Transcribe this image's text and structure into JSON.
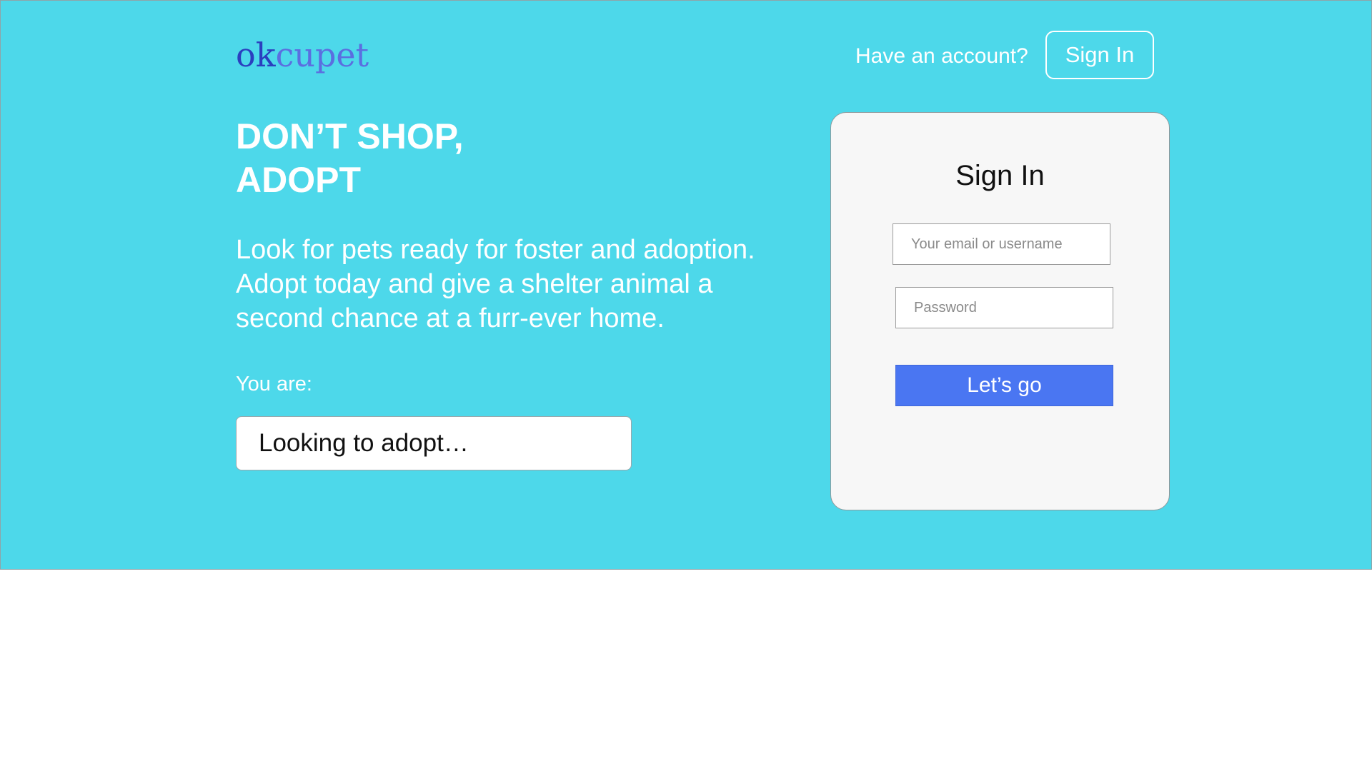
{
  "brand": {
    "logo_part1": "ok",
    "logo_part2": "cupet",
    "colors": {
      "logo_dark": "#2b3fbf",
      "logo_light": "#5b6ee0"
    }
  },
  "header": {
    "have_account_text": "Have an account?",
    "signin_button_label": "Sign In"
  },
  "hero": {
    "background_color": "#4dd8ea",
    "headline_line1": "DON’T SHOP,",
    "headline_line2": "ADOPT",
    "tagline": "Look for pets ready for foster and adoption. Adopt today and give a shelter animal a second chance at a furr-ever home.",
    "you_are_label": "You are:",
    "role_select_value": "Looking to adopt…"
  },
  "signin_card": {
    "title": "Sign In",
    "email_placeholder": "Your email or username",
    "email_value": "",
    "password_placeholder": "Password",
    "password_value": "",
    "submit_label": "Let’s go",
    "submit_color": "#4a76f2"
  }
}
